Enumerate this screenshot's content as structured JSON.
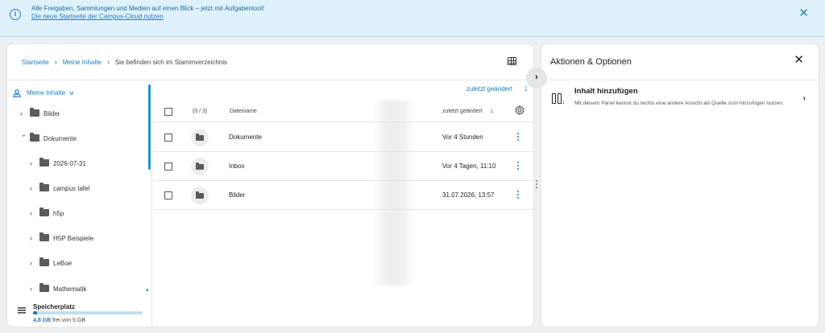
{
  "banner": {
    "message": "Alle Freigaben, Sammlungen und Medien auf einen Blick – jetzt mit Aufgabentool!",
    "link": "Die neue Startseite der Campus-Cloud nutzen",
    "close_glyph": "✕",
    "info_glyph": "i"
  },
  "breadcrumb": {
    "items": [
      "Startseite",
      "Meine Inhalte"
    ],
    "current": "Sie befinden sich im Stammverzeichnis",
    "separator": "›"
  },
  "sidebar": {
    "root_label": "Meine Inhalte",
    "items": [
      {
        "label": "Bilder",
        "expanded": false
      },
      {
        "label": "Dokumente",
        "expanded": true
      },
      {
        "label": "2026-07-31",
        "expanded": false
      },
      {
        "label": "campus tafel",
        "expanded": false
      },
      {
        "label": "h5p",
        "expanded": false
      },
      {
        "label": "H5P Beispiele",
        "expanded": false
      },
      {
        "label": "LeBoe",
        "expanded": false
      },
      {
        "label": "Mathematik",
        "expanded": false
      }
    ]
  },
  "storage": {
    "title": "Speicherplatz",
    "used": "4,8 GB",
    "rest": "frei von 5 GB",
    "fraction_used": 0.04
  },
  "files": {
    "sort_label": "zuletzt geändert",
    "header": {
      "count": "(0 / 3)",
      "name": "Dateiname",
      "modified": "zuletzt geändert"
    },
    "rows": [
      {
        "name": "Dokumente",
        "modified": "Vor 4 Stunden"
      },
      {
        "name": "Inbox",
        "modified": "Vor 4 Tagen, 11:10"
      },
      {
        "name": "Bilder",
        "modified": "31.07.2026, 13:57"
      }
    ]
  },
  "right_panel": {
    "title": "Aktionen & Optionen",
    "option_title": "Inhalt hinzufügen",
    "option_desc": "Mit diesem Panel kannst du rechts eine andere Ansicht als Quelle zum hinzufügen nutzen."
  },
  "colors": {
    "accent": "#1a7dc1",
    "banner_bg": "#dff1fb",
    "page_bg": "#eef0f2"
  }
}
